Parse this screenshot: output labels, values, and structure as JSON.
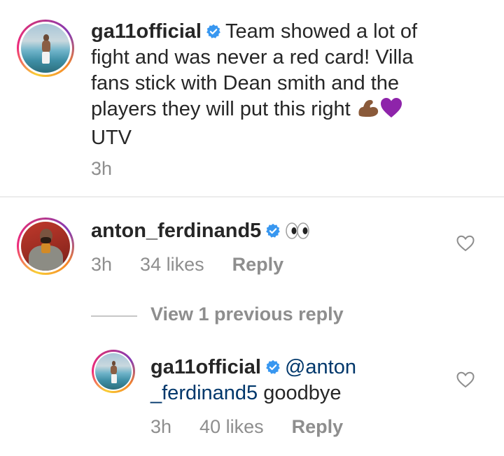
{
  "comments": [
    {
      "username": "ga11official",
      "text": "Team showed a lot of fight and was never a red card! Villa fans stick with Dean smith and the players they will put this right",
      "emoji": "flexed-biceps-brown, purple-heart",
      "text_after_emoji": "UTV",
      "time": "3h"
    },
    {
      "username": "anton_ferdinand5",
      "emoji": "eyes",
      "time": "3h",
      "likes": "34 likes",
      "reply_label": "Reply"
    }
  ],
  "view_replies_label": "View 1 previous reply",
  "reply": {
    "username": "ga11official",
    "mention": "@anton _ferdinand5",
    "text": "goodbye",
    "time": "3h",
    "likes": "40 likes",
    "reply_label": "Reply"
  },
  "colors": {
    "verified_blue": "#3897f0",
    "meta_gray": "#8e8e8e",
    "mention_blue": "#00376b"
  }
}
